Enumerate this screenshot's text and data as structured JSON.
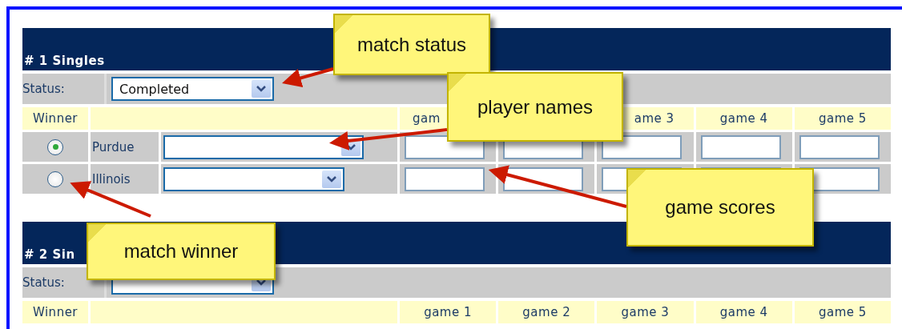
{
  "sections": [
    {
      "title": "# 1 Singles",
      "status_label": "Status:",
      "status_value": "Completed",
      "winner_label": "Winner",
      "games": [
        {
          "kind": "label",
          "label": "gam"
        },
        {
          "kind": "covered"
        },
        {
          "kind": "label",
          "label": "ame 3"
        },
        {
          "kind": "label",
          "label": "game 4"
        },
        {
          "kind": "label",
          "label": "game 5"
        }
      ],
      "rows": [
        {
          "team": "Purdue",
          "selected": true
        },
        {
          "team": "Illinois",
          "selected": false
        }
      ]
    },
    {
      "title": "# 2 Sin",
      "status_label": "Status:",
      "winner_label": "Winner",
      "games": [
        {
          "kind": "label",
          "label": "game 1"
        },
        {
          "kind": "label",
          "label": "game 2"
        },
        {
          "kind": "label",
          "label": "game 3"
        },
        {
          "kind": "label",
          "label": "game 4"
        },
        {
          "kind": "label",
          "label": "game 5"
        }
      ]
    }
  ],
  "callouts": [
    {
      "text": "match status"
    },
    {
      "text": "player names"
    },
    {
      "text": "game scores"
    },
    {
      "text": "match winner"
    }
  ]
}
